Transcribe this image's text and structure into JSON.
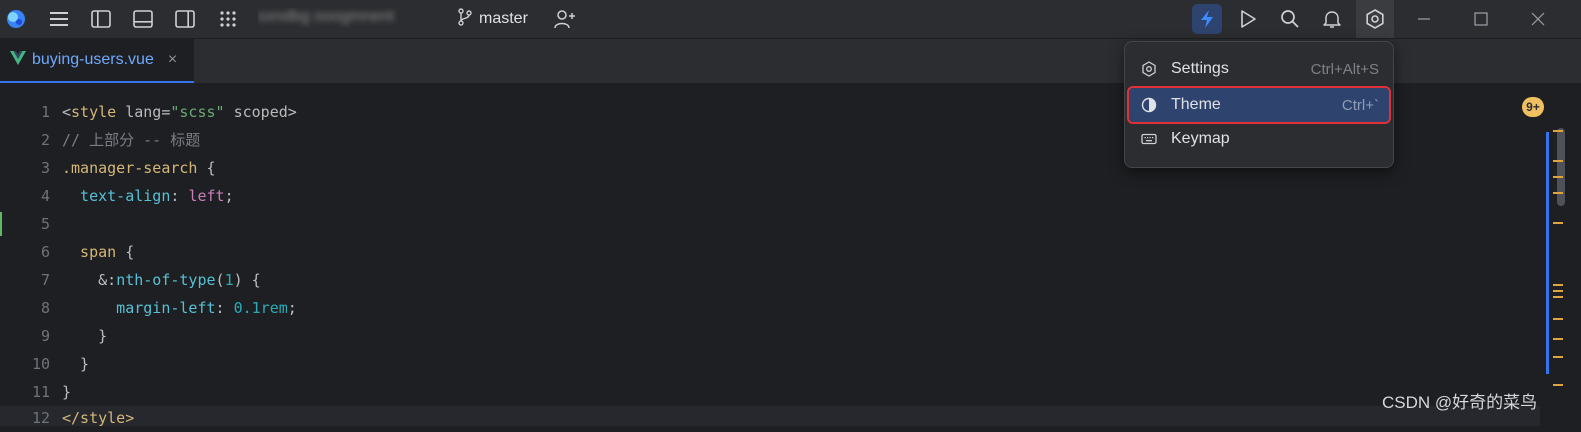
{
  "titlebar": {
    "project_name": "sxndbg  ooogmnent",
    "branch": "master",
    "icons": [
      "app-logo-icon",
      "hamburger-menu-icon",
      "left-panel-icon",
      "bottom-panel-icon",
      "right-panel-icon",
      "apps-grid-icon",
      "git-branch-icon",
      "add-user-icon",
      "bolt-icon",
      "run-icon",
      "search-icon",
      "bell-icon",
      "gear-icon",
      "minimize-icon",
      "maximize-icon",
      "close-icon"
    ]
  },
  "tab": {
    "label": "buying-users.vue",
    "close": "×"
  },
  "editor": {
    "lines": [
      {
        "n": "1"
      },
      {
        "n": "2"
      },
      {
        "n": "3"
      },
      {
        "n": "4"
      },
      {
        "n": "5"
      },
      {
        "n": "6"
      },
      {
        "n": "7"
      },
      {
        "n": "8"
      },
      {
        "n": "9"
      },
      {
        "n": "10"
      },
      {
        "n": "11"
      },
      {
        "n": "12"
      }
    ],
    "tokens": {
      "l1_open": "<",
      "l1_tag": "style",
      "l1_attr1": " lang",
      "l1_eq": "=",
      "l1_str": "\"scss\"",
      "l1_attr2": " scoped",
      "l1_close": ">",
      "l2_comment": "// 上部分 -- 标题",
      "l3_sel": ".manager-search",
      "l3_brace": " {",
      "l4_prop": "  text-align",
      "l4_colon": ": ",
      "l4_val": "left",
      "l4_semi": ";",
      "l6_sel": "  span",
      "l6_brace": " {",
      "l7_amp": "    &:",
      "l7_fn": "nth-of-type",
      "l7_paren_open": "(",
      "l7_num": "1",
      "l7_paren_close": ")",
      "l7_brace": " {",
      "l8_prop": "      margin-left",
      "l8_colon": ": ",
      "l8_num": "0.1rem",
      "l8_semi": ";",
      "l9": "    }",
      "l10": "  }",
      "l11": "}",
      "l12": "</style>"
    },
    "badge": "9+"
  },
  "menu": {
    "items": [
      {
        "label": "Settings",
        "shortcut": "Ctrl+Alt+S",
        "icon": "gear-icon"
      },
      {
        "label": "Theme",
        "shortcut": "Ctrl+`",
        "icon": "theme-icon"
      },
      {
        "label": "Keymap",
        "shortcut": "",
        "icon": "keyboard-icon"
      }
    ]
  },
  "watermark": "CSDN @好奇的菜鸟",
  "colors": {
    "accent": "#3574f0",
    "selected_bg": "#2e436e",
    "highlight_border": "#e0303a"
  }
}
